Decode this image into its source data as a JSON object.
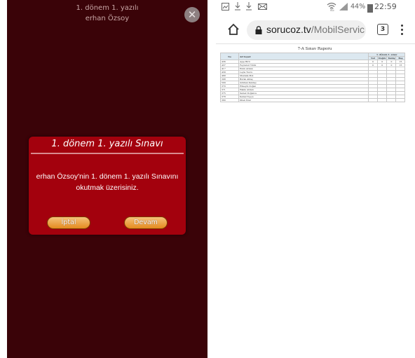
{
  "left_screen": {
    "title_line1": "1. dönem 1. yazılı",
    "title_line2": "erhan Özsoy",
    "close_icon": "close-icon"
  },
  "dialog": {
    "title": "1. dönem 1. yazılı Sınavı",
    "message_line1": "erhan Özsoy'nin 1. dönem 1. yazılı Sınavını",
    "message_line2": "okutmak üzerisiniz.",
    "cancel_label": "İptal",
    "continue_label": "Devam"
  },
  "status_bar": {
    "icons": [
      "screenshot-icon",
      "download-icon",
      "download-icon",
      "mail-icon"
    ],
    "battery_percent": "44%",
    "time": "22:59"
  },
  "browser": {
    "url_domain": "sorucoz.tv",
    "url_path": "/MobilServic",
    "tab_count": "3"
  },
  "report": {
    "title": "7-A Sınav Raporu",
    "headers": {
      "no": "No",
      "name": "Ad Soyad",
      "group": "1. dönem 1. sınav",
      "sub": [
        "Net",
        "Doğru",
        "Yanlış",
        "Boş"
      ]
    },
    "rows": [
      {
        "no": "436",
        "name": "Ayşe Birli",
        "vals": [
          "0",
          "0",
          "0",
          "15"
        ]
      },
      {
        "no": "437",
        "name": "Feyzanur Yildiz",
        "vals": [
          "0",
          "0",
          "0",
          "15"
        ]
      },
      {
        "no": "417",
        "name": "Emin Arslan",
        "vals": [
          "",
          "",
          "",
          ""
        ]
      },
      {
        "no": "439",
        "name": "Leyla Tuzcu",
        "vals": [
          "",
          "",
          "",
          ""
        ]
      },
      {
        "no": "468",
        "name": "Mustafa Mut",
        "vals": [
          "",
          "",
          "",
          ""
        ]
      },
      {
        "no": "398",
        "name": "Burak Aktaş",
        "vals": [
          "",
          "",
          "",
          ""
        ]
      },
      {
        "no": "509",
        "name": "Gökhan Kanbey",
        "vals": [
          "",
          "",
          "",
          ""
        ]
      },
      {
        "no": "370",
        "name": "Hüseyin Doğan",
        "vals": [
          "",
          "",
          "",
          ""
        ]
      },
      {
        "no": "371",
        "name": "Hakkı Arslan",
        "vals": [
          "",
          "",
          "",
          ""
        ]
      },
      {
        "no": "375",
        "name": "Samet Doğanca",
        "vals": [
          "",
          "",
          "",
          ""
        ]
      },
      {
        "no": "378",
        "name": "Kemal Topçu",
        "vals": [
          "",
          "",
          "",
          ""
        ]
      },
      {
        "no": "380",
        "name": "Dilek Özal",
        "vals": [
          "",
          "",
          "",
          ""
        ]
      }
    ]
  },
  "colors": {
    "left_background": "#3a0308",
    "dialog_background": "#a3010d",
    "button_orange": "#e48a1f",
    "report_header": "#dce8f0"
  }
}
